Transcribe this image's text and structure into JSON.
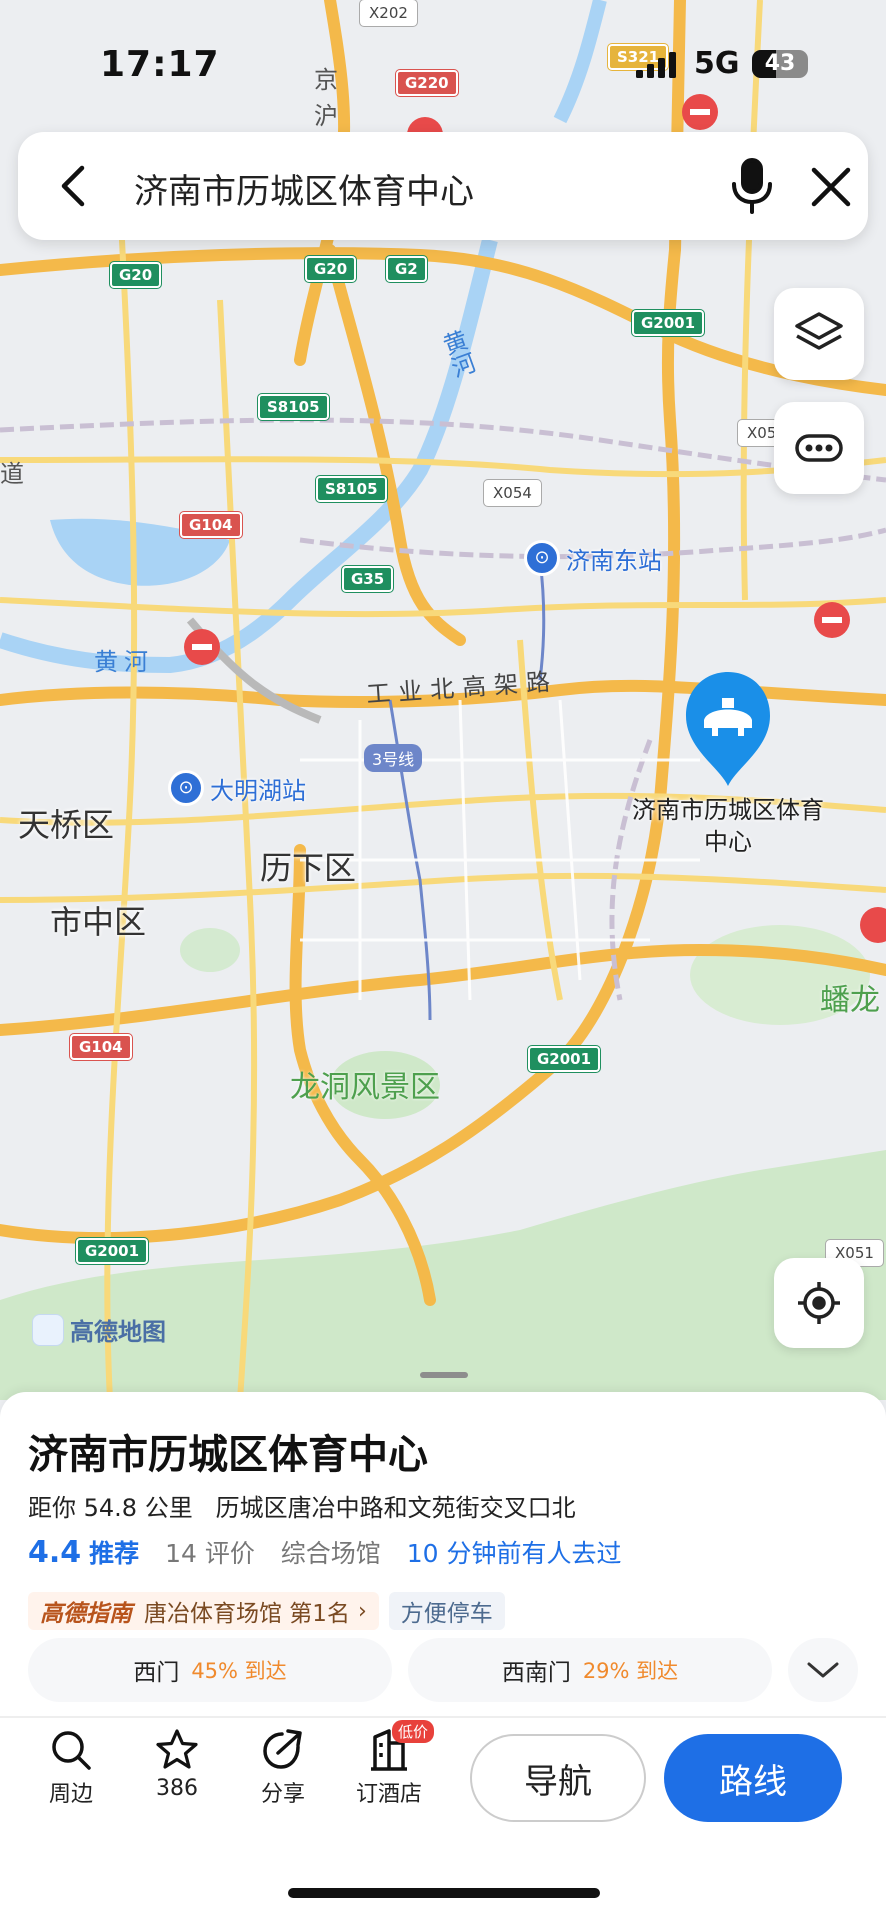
{
  "status": {
    "time": "17:17",
    "network": "5G",
    "battery": "43",
    "battery_level": 0.43
  },
  "search": {
    "query": "济南市历城区体育中心"
  },
  "map": {
    "districts": [
      "天桥区",
      "历下区",
      "市中区"
    ],
    "scenic": "龙洞风景区",
    "partial_district": "蟠龙",
    "stations": [
      "济南东站",
      "大明湖站"
    ],
    "river_labels": [
      "黄河",
      "黄河"
    ],
    "elevated_road": "工业北高架路",
    "metro_line": "3号线",
    "side_labels": [
      "京",
      "沪",
      "道"
    ],
    "road_badges": [
      "X202",
      "G220",
      "S321",
      "G20",
      "G20",
      "G2",
      "G2001",
      "S8105",
      "S8105",
      "X054",
      "G104",
      "G35",
      "X05",
      "G104",
      "G2001",
      "G2001",
      "X051"
    ],
    "pin_label": "济南市历城区体育中心",
    "brand_watermark": "高德地图"
  },
  "place": {
    "name": "济南市历城区体育中心",
    "distance": "距你 54.8 公里",
    "address": "历城区唐冶中路和文苑街交叉口北",
    "score": "4.4",
    "recommend": "推荐",
    "reviews": "14 评价",
    "category": "综合场馆",
    "recent": "10 分钟前有人去过",
    "rank_brand": "高德指南",
    "rank_text": "唐冶体育场馆 第1名",
    "tag_parking": "方便停车",
    "gates": [
      {
        "name": "西门",
        "arrival": "45% 到达"
      },
      {
        "name": "西南门",
        "arrival": "29% 到达"
      }
    ]
  },
  "toolbar": {
    "nearby": "周边",
    "favorites": "386",
    "share": "分享",
    "hotel": "订酒店",
    "hotel_badge": "低价",
    "navigate": "导航",
    "route": "路线"
  },
  "colors": {
    "accent": "#1e6fe6",
    "pin": "#1a8fe8",
    "arrival_pct": "#f08a2d"
  }
}
